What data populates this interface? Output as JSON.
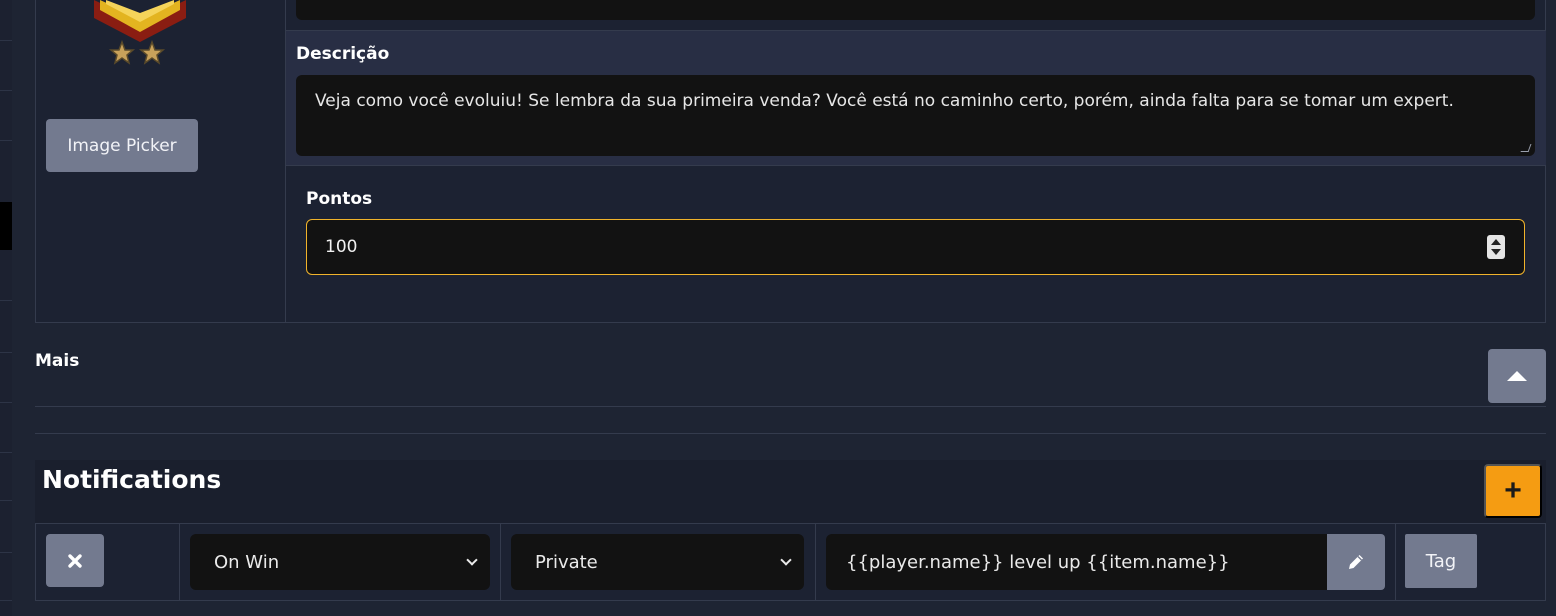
{
  "achievement": {
    "image_picker_label": "Image Picker",
    "description_label": "Descrição",
    "description_value": "Veja como você evoluiu! Se lembra da sua primeira venda? Você está no caminho certo, porém, ainda falta para se tomar um expert.",
    "points_label": "Pontos",
    "points_value": "100"
  },
  "more": {
    "label": "Mais",
    "toggle_icon": "caret-up-icon"
  },
  "notifications": {
    "title": "Notifications",
    "add_icon": "plus-icon",
    "rows": [
      {
        "remove_icon": "close-icon",
        "event": "On Win",
        "visibility": "Private",
        "message": "{{player.name}} level up {{item.name}}",
        "edit_icon": "pencil-icon",
        "tag_label": "Tag"
      }
    ]
  },
  "colors": {
    "accent": "#f59c12",
    "focus_border": "#f0b32b",
    "button_grey": "#737a8f",
    "input_bg": "#121212",
    "page_bg": "#1e2433"
  }
}
